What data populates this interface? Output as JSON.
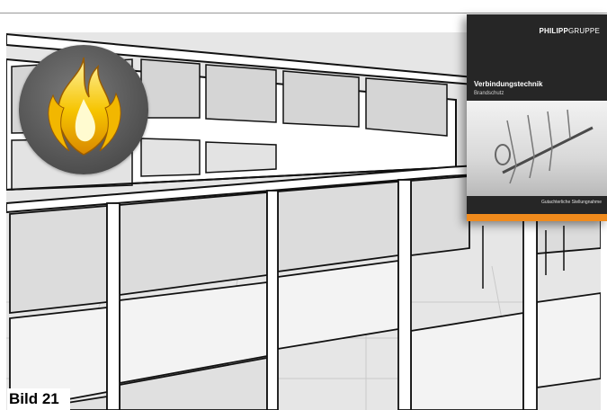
{
  "caption": "Bild 21",
  "brochure": {
    "brand_prefix": "PHILIPP",
    "brand_suffix": "GRUPPE",
    "title": "Verbindungstechnik",
    "subtitle": "Brandschutz",
    "footer_text": "Gutachterliche Stellungnahme"
  },
  "colors": {
    "accent_orange": "#f08a1c",
    "flame_outer": "#e8b800",
    "flame_inner": "#fff7a0",
    "badge": "#5a5a5a"
  },
  "icons": [
    "fire-icon"
  ]
}
